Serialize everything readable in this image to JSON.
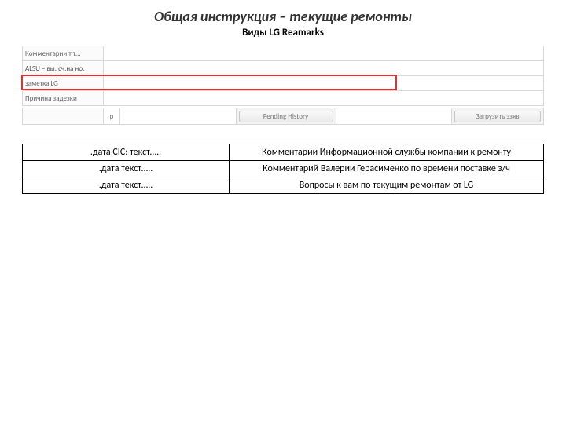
{
  "title": "Общая инструкция – текущие ремонты",
  "subtitle": "Виды LG Reamarks",
  "shot": {
    "row1_label": "Комментарии т.т…",
    "row2_label_fragment": "ALSU – вы. сч.на но.",
    "row3_label": "заметка LG",
    "row4_label": "Причина задезки"
  },
  "bottom_bar": {
    "label_p": "p",
    "btn_pending": "Pending History",
    "btn_load": "Загрузить ззяв"
  },
  "map": {
    "left": [
      ".дата CIC: текст…..",
      ".дата текст…..",
      ".дата текст….."
    ],
    "right": [
      "Комментарии Информационной службы компании к ремонту",
      "Комментарий Валерии Герасименко по времени поставке з/ч",
      "Вопросы к вам по текущим ремонтам от LG"
    ]
  }
}
